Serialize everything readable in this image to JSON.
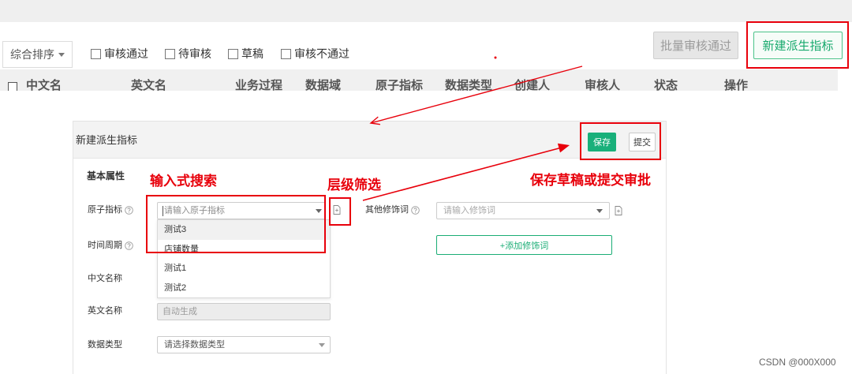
{
  "toolbar": {
    "sort_label": "综合排序",
    "filters": [
      {
        "label": "审核通过",
        "checked": false
      },
      {
        "label": "待审核",
        "checked": false
      },
      {
        "label": "草稿",
        "checked": false
      },
      {
        "label": "审核不通过",
        "checked": false
      }
    ],
    "batch_approve_label": "批量审核通过",
    "new_metric_label": "新建派生指标"
  },
  "table": {
    "columns": [
      "中文名",
      "英文名",
      "业务过程",
      "数据域",
      "原子指标",
      "数据类型",
      "创建人",
      "审核人",
      "状态",
      "操作"
    ]
  },
  "dialog": {
    "title": "新建派生指标",
    "save_label": "保存",
    "submit_label": "提交",
    "section_title": "基本属性",
    "fields": {
      "atomic_metric": {
        "label": "原子指标",
        "placeholder": "请输入原子指标",
        "options": [
          "测试3",
          "店铺数量",
          "测试1",
          "测试2"
        ],
        "highlighted_index": 0
      },
      "modifier": {
        "label": "其他修饰词",
        "placeholder": "请输入修饰词",
        "add_label": "+添加修饰词"
      },
      "time_period": {
        "label": "时间周期"
      },
      "cn_name": {
        "label": "中文名称"
      },
      "en_name": {
        "label": "英文名称",
        "value": "自动生成"
      },
      "data_type": {
        "label": "数据类型",
        "placeholder": "请选择数据类型"
      }
    }
  },
  "annotations": {
    "search": "输入式搜索",
    "filter": "层级筛选",
    "save_submit": "保存草稿或提交审批"
  },
  "watermark": "CSDN @000X000",
  "colors": {
    "accent_green": "#1aad75",
    "annotation_red": "#e8000b",
    "disabled_gray": "#e6e6e6"
  }
}
